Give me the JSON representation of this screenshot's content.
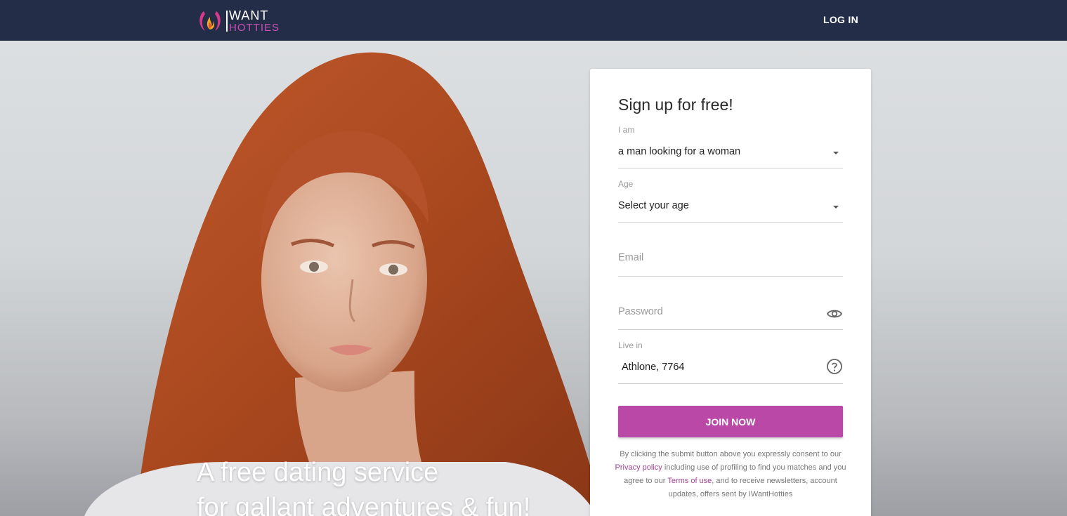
{
  "header": {
    "logo_top": "WANT",
    "logo_bottom": "HOTTIES",
    "login_label": "LOG IN"
  },
  "hero": {
    "tagline_line1": "A free dating service",
    "tagline_line2": "for gallant adventures & fun!"
  },
  "signup": {
    "title": "Sign up for free!",
    "iam_label": "I am",
    "iam_value": "a man looking for a woman",
    "age_label": "Age",
    "age_value": "Select your age",
    "email_placeholder": "Email",
    "password_placeholder": "Password",
    "live_label": "Live in",
    "live_value": "Athlone, 7764",
    "join_label": "JOIN NOW",
    "consent_part1": "By clicking the submit button above you expressly consent to our ",
    "privacy_link": "Privacy policy",
    "consent_part2": " including use of profiling to find you matches and you agree to our ",
    "terms_link": "Terms of use",
    "consent_part3": ", and to receive newsletters, account updates, offers sent by IWantHotties"
  },
  "colors": {
    "header_bg": "#232d47",
    "accent": "#b948a6",
    "logo_pink": "#c94fb6",
    "hair": "#b4502a"
  },
  "icons": [
    "logo-flame-icon",
    "caret-down-icon",
    "eye-icon",
    "help-circle-icon"
  ]
}
